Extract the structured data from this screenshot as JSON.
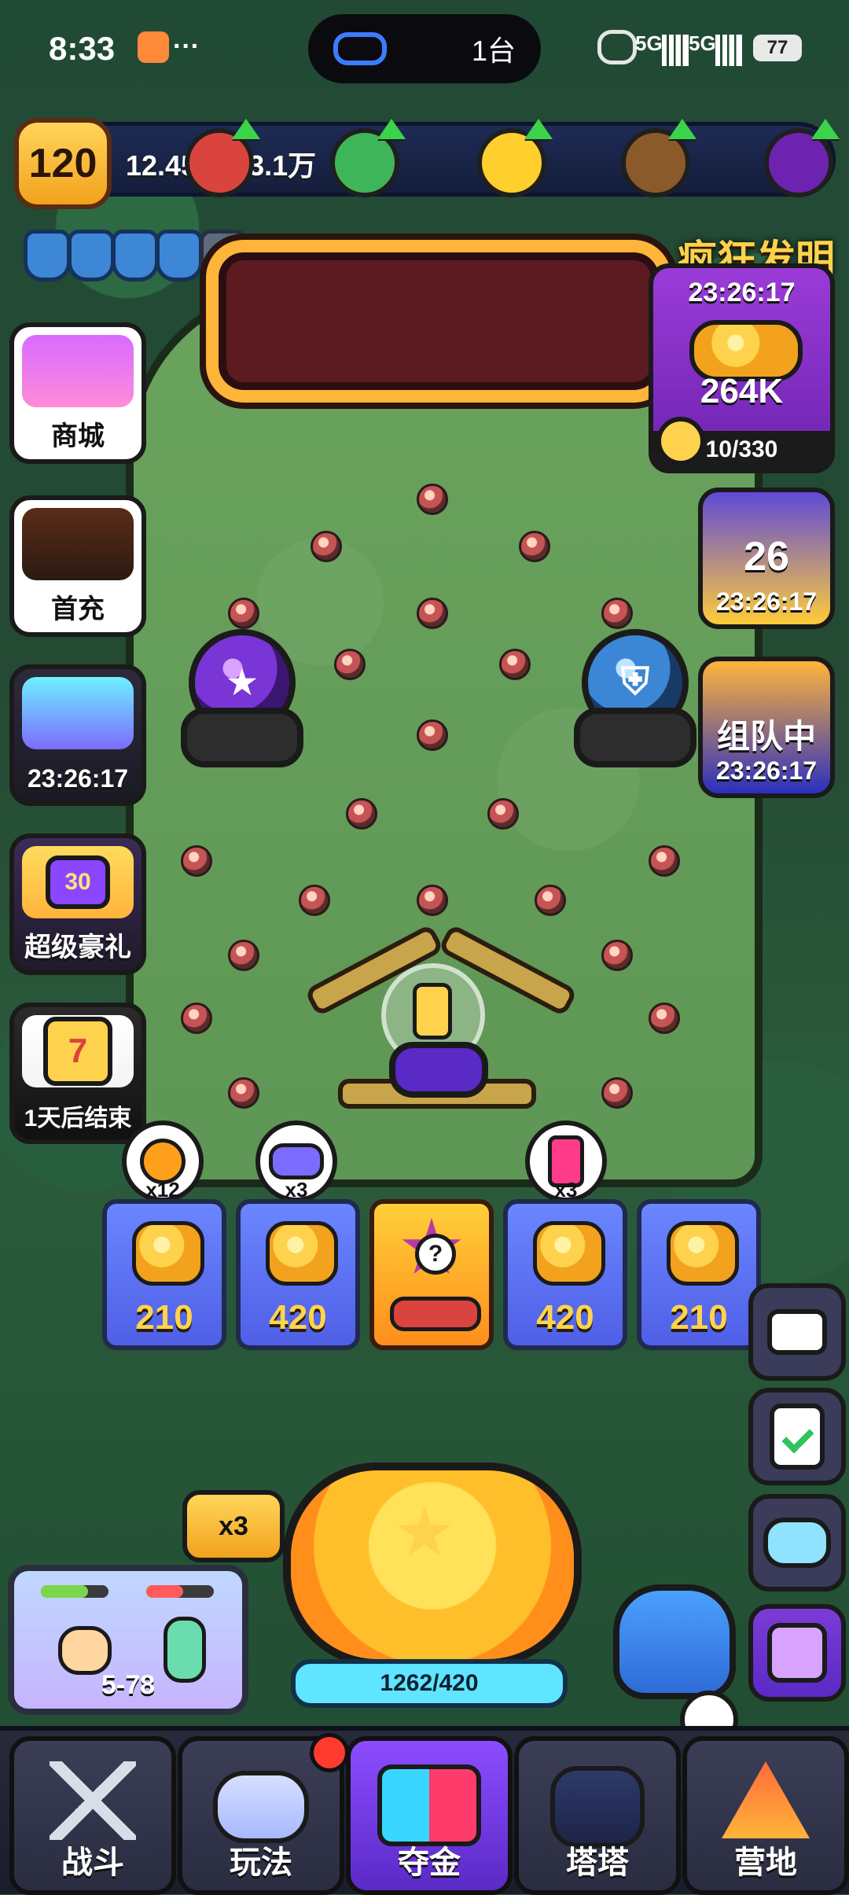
{
  "status_bar": {
    "time": "8:33",
    "extra": "···",
    "pill_text": "1台",
    "signal_1": "5G",
    "signal_2": "5G",
    "battery": "77"
  },
  "topbar": {
    "level": "120",
    "resource_text": "12.45万/13.1万"
  },
  "left_menu": {
    "shop_label": "商城",
    "first_charge_label": "首充",
    "event_timer": "23:26:17",
    "super_gift_label": "超级豪礼",
    "calendar_label": "1天后结束",
    "super_gift_level": "30",
    "calendar_day": "7"
  },
  "promo": {
    "title": "疯狂发明",
    "timer": "23:26:17",
    "amount": "264K",
    "progress": "10/330",
    "progress_fraction": 0.0303
  },
  "right_menu": {
    "checker_count": "26",
    "checker_timer": "23:26:17",
    "team_label": "组队中",
    "team_timer": "23:26:17"
  },
  "prize_slots": {
    "values": [
      "210",
      "420",
      "420",
      "210"
    ],
    "bubbles": [
      "x12",
      "x3",
      "x3"
    ]
  },
  "bottom": {
    "multiplier": "x3",
    "spin_count": "1262/420",
    "stage": "5-78"
  },
  "nav": {
    "battle": "战斗",
    "play": "玩法",
    "gold": "夺金",
    "tower": "塔塔",
    "camp": "营地"
  },
  "colors": {
    "accent_gold": "#ffd24d",
    "accent_purple": "#8c4cff",
    "board_green": "#6aa35d",
    "slot_blue": "#6b86ff"
  }
}
